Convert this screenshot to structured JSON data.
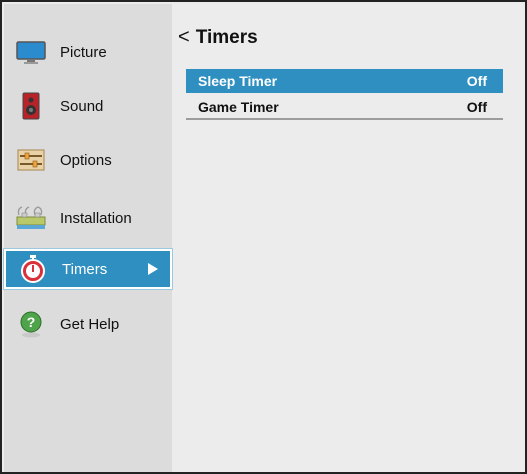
{
  "sidebar": {
    "items": [
      {
        "label": "Picture",
        "icon": "monitor-icon"
      },
      {
        "label": "Sound",
        "icon": "speaker-icon"
      },
      {
        "label": "Options",
        "icon": "sliders-icon"
      },
      {
        "label": "Installation",
        "icon": "network-icon"
      },
      {
        "label": "Timers",
        "icon": "stopwatch-icon",
        "active": true
      },
      {
        "label": "Get Help",
        "icon": "help-icon"
      }
    ]
  },
  "header": {
    "back_glyph": "<",
    "title": "Timers"
  },
  "rows": [
    {
      "label": "Sleep Timer",
      "value": "Off",
      "selected": true
    },
    {
      "label": "Game Timer",
      "value": "Off",
      "selected": false
    }
  ],
  "colors": {
    "accent": "#2e8fc0",
    "sidebar_bg": "#dcdcdc",
    "content_bg": "#ececec"
  }
}
